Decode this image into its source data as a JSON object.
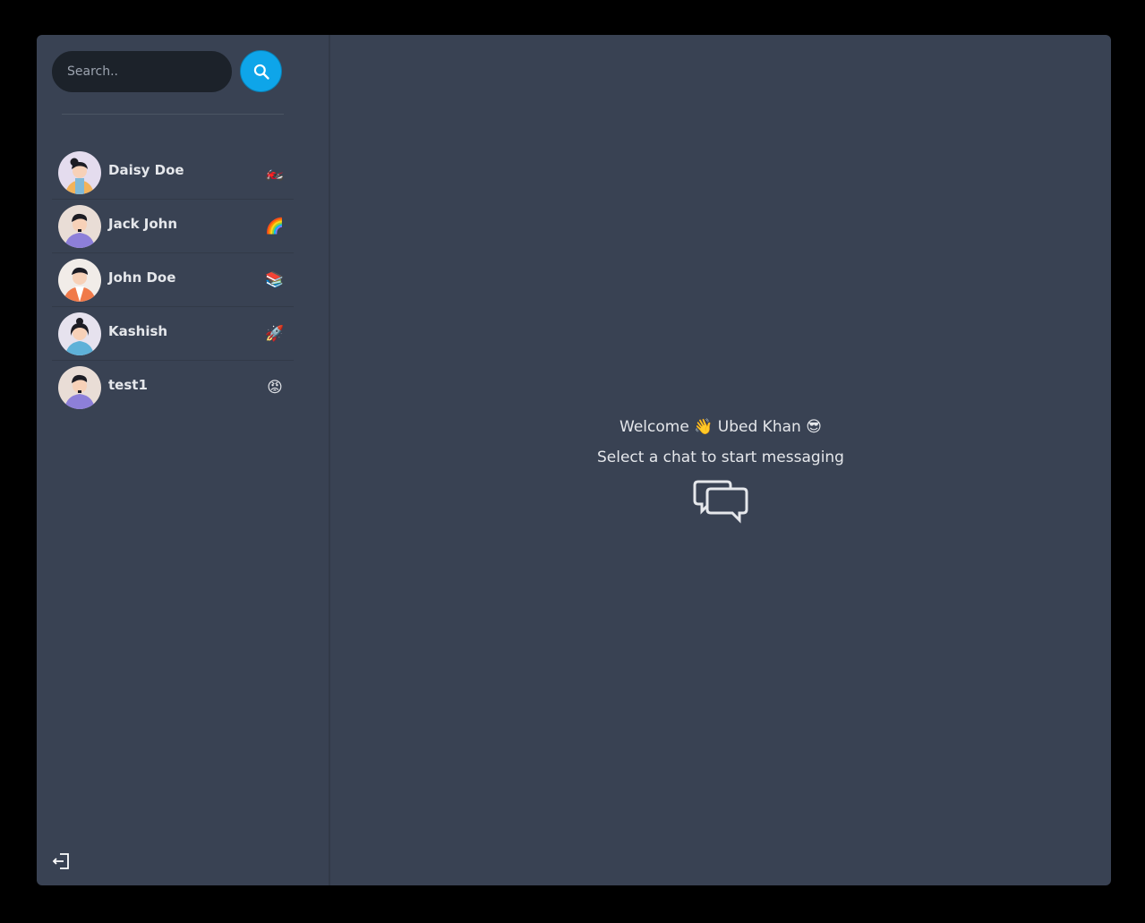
{
  "search": {
    "placeholder": "Search.."
  },
  "contacts": [
    {
      "name": "Daisy Doe",
      "emoji": "🏍️",
      "avatar": "female-avatar-1"
    },
    {
      "name": "Jack John",
      "emoji": "🌈",
      "avatar": "male-avatar-1"
    },
    {
      "name": "John Doe",
      "emoji": "📚",
      "avatar": "male-avatar-2"
    },
    {
      "name": "Kashish",
      "emoji": "🚀",
      "avatar": "female-avatar-2"
    },
    {
      "name": "test1",
      "emoji": "😡",
      "avatar": "male-avatar-1"
    }
  ],
  "welcome": {
    "prefix": "Welcome",
    "wave_emoji": "👋",
    "user_name": "Ubed Khan",
    "cool_emoji": "😎",
    "subtitle": "Select a chat to start messaging"
  },
  "icons": {
    "search": "search-icon",
    "logout": "logout-icon",
    "chat": "chat-bubbles-icon"
  },
  "colors": {
    "accent": "#0ea5e9",
    "panel": "#394253",
    "background": "#000000"
  }
}
